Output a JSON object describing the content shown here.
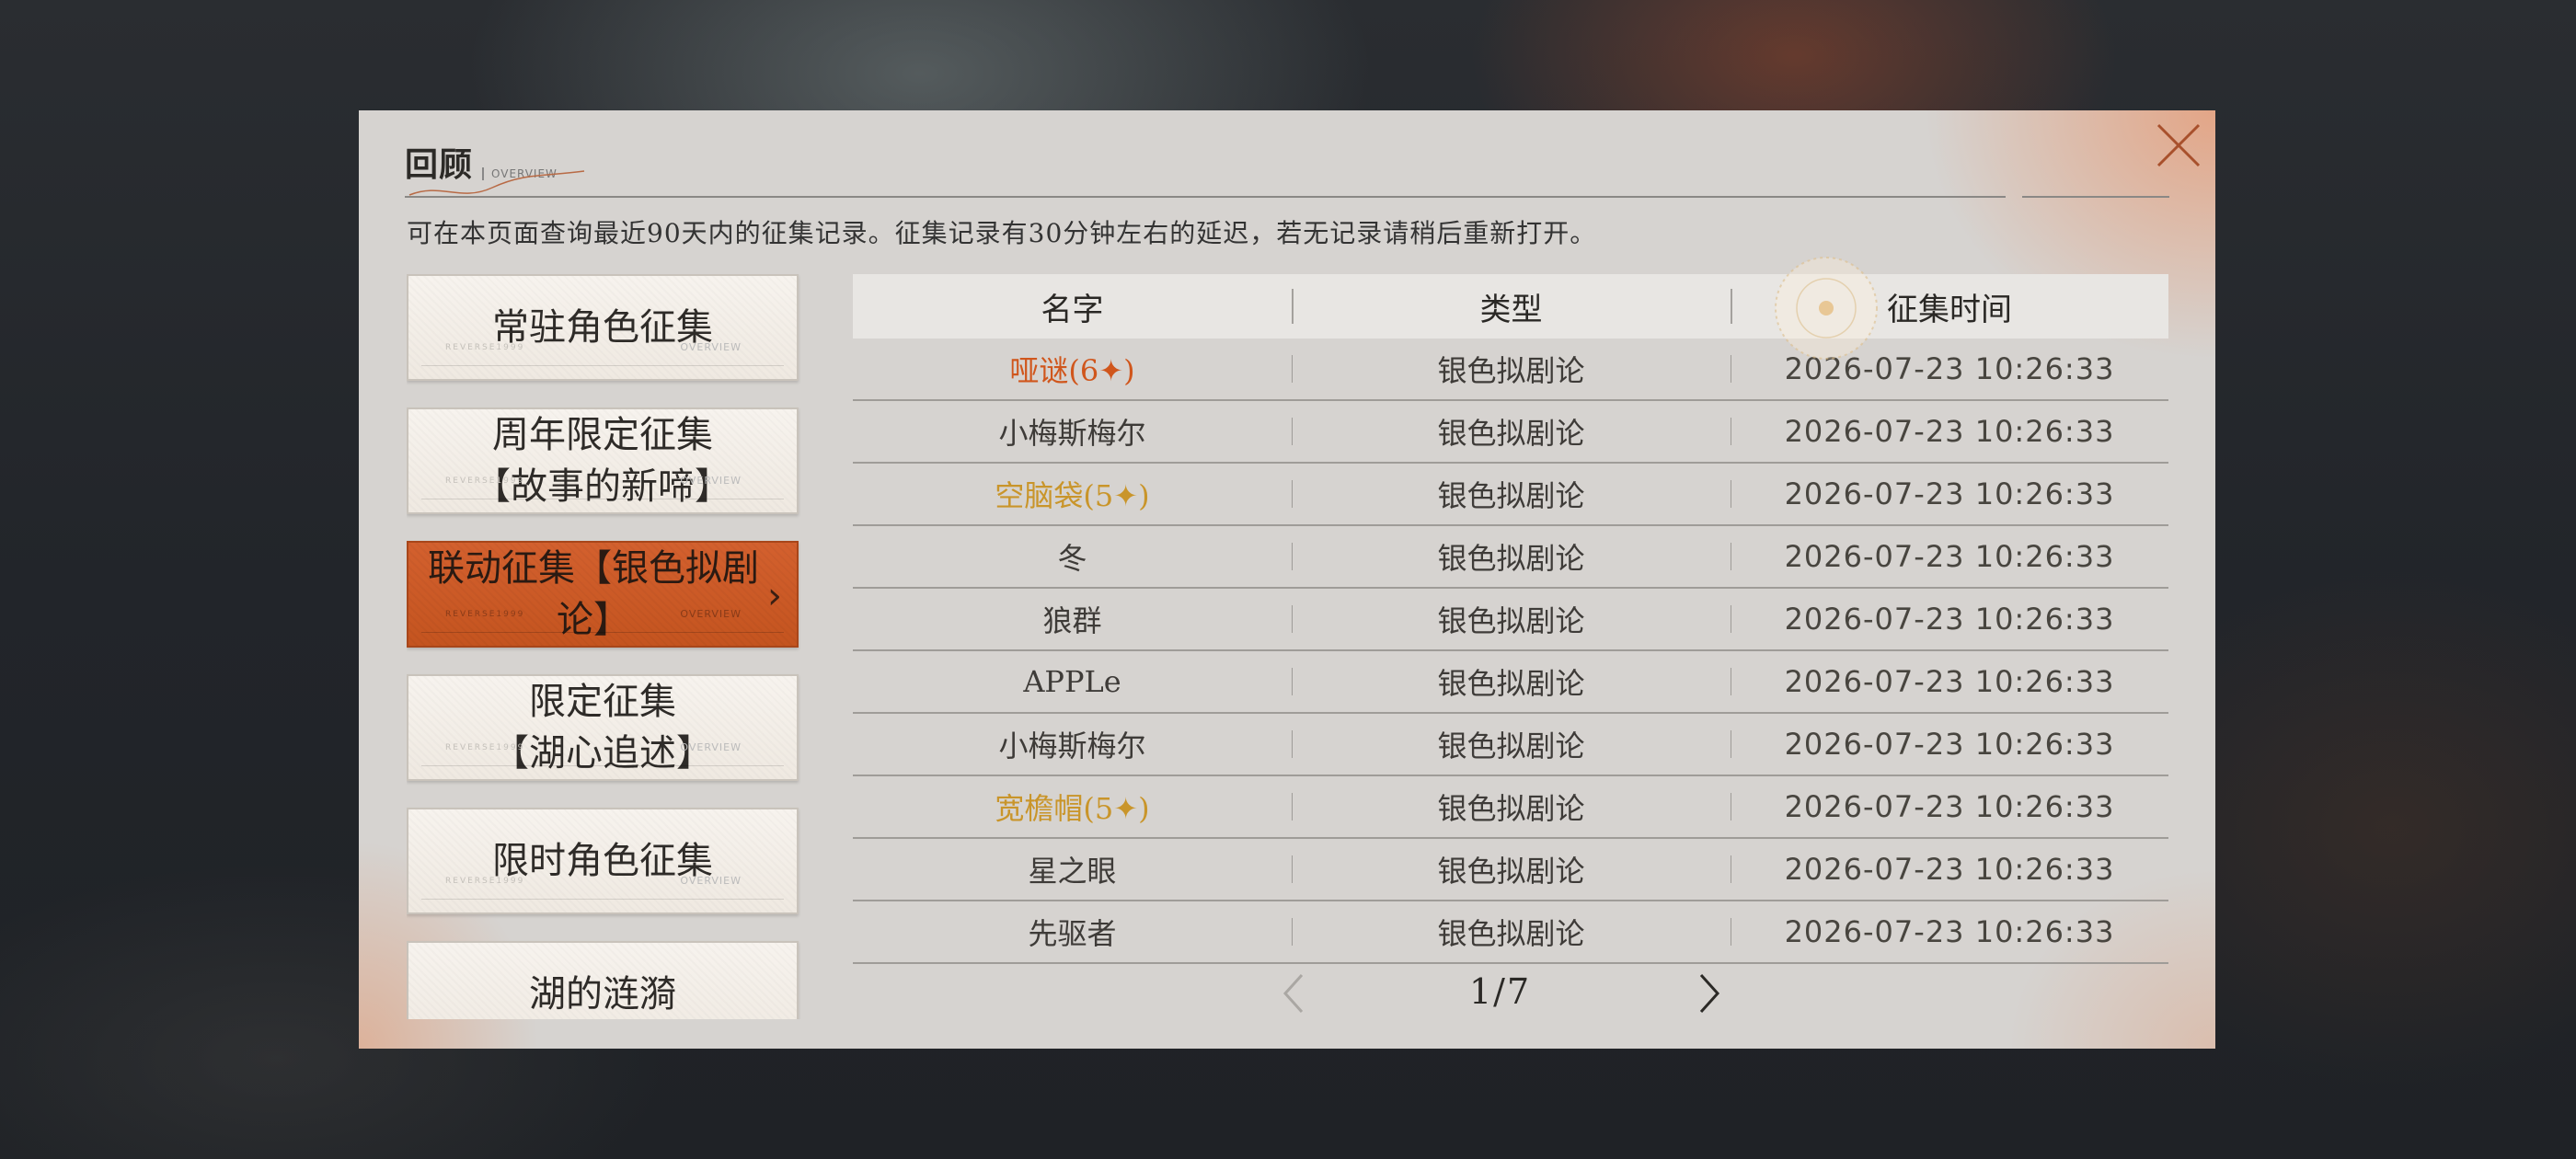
{
  "header": {
    "title": "回顾",
    "subtitle": "OVERVIEW",
    "notice": "可在本页面查询最近90天内的征集记录。征集记录有30分钟左右的延迟，若无记录请稍后重新打开。"
  },
  "sidebar": {
    "items": [
      {
        "label": "常驻角色征集",
        "active": false
      },
      {
        "label": "周年限定征集\n【故事的新啼】",
        "active": false
      },
      {
        "label": "联动征集【银色拟剧论】",
        "active": true
      },
      {
        "label": "限定征集\n【湖心追述】",
        "active": false
      },
      {
        "label": "限时角色征集",
        "active": false
      },
      {
        "label": "湖的涟漪",
        "active": false
      }
    ],
    "card_deco": "OVERVIEW",
    "card_deco_left": "REVERSE1999"
  },
  "table": {
    "columns": [
      "名字",
      "类型",
      "征集时间"
    ],
    "rows": [
      {
        "name": "哑谜(6✦)",
        "type": "银色拟剧论",
        "time": "2026-07-23 10:26:33",
        "rarity": 6
      },
      {
        "name": "小梅斯梅尔",
        "type": "银色拟剧论",
        "time": "2026-07-23 10:26:33",
        "rarity": 0
      },
      {
        "name": "空脑袋(5✦)",
        "type": "银色拟剧论",
        "time": "2026-07-23 10:26:33",
        "rarity": 5
      },
      {
        "name": "冬",
        "type": "银色拟剧论",
        "time": "2026-07-23 10:26:33",
        "rarity": 0
      },
      {
        "name": "狼群",
        "type": "银色拟剧论",
        "time": "2026-07-23 10:26:33",
        "rarity": 0
      },
      {
        "name": "APPLe",
        "type": "银色拟剧论",
        "time": "2026-07-23 10:26:33",
        "rarity": 0
      },
      {
        "name": "小梅斯梅尔",
        "type": "银色拟剧论",
        "time": "2026-07-23 10:26:33",
        "rarity": 0
      },
      {
        "name": "宽檐帽(5✦)",
        "type": "银色拟剧论",
        "time": "2026-07-23 10:26:33",
        "rarity": 5
      },
      {
        "name": "星之眼",
        "type": "银色拟剧论",
        "time": "2026-07-23 10:26:33",
        "rarity": 0
      },
      {
        "name": "先驱者",
        "type": "银色拟剧论",
        "time": "2026-07-23 10:26:33",
        "rarity": 0
      }
    ]
  },
  "pager": {
    "label": "1/7",
    "current": 1,
    "total": 7
  },
  "colors": {
    "accent": "#d0561c",
    "gold": "#c9952a",
    "panel": "#d6d3d0"
  },
  "icons": {
    "close": "close-icon",
    "prev": "chevron-left-icon",
    "next": "chevron-right-icon"
  }
}
